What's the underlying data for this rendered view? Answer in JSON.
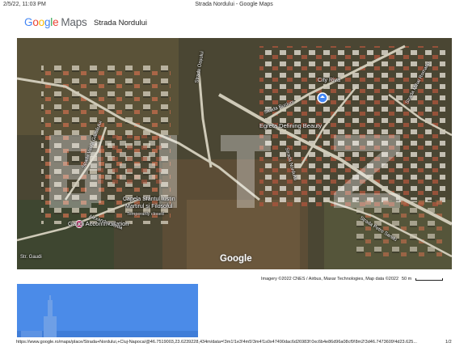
{
  "header": {
    "datetime": "2/5/22, 11:03 PM",
    "title": "Strada Nordului - Google Maps"
  },
  "logo": {
    "google": "Google",
    "maps": "Maps"
  },
  "place_name": "Strada Nordului",
  "map": {
    "watermark_text": "BITZ",
    "labels": {
      "city_riva": "City Riva",
      "egreta": "Egreta Defining Beauty",
      "capela_1": "Capela Sfântul Iustin",
      "capela_2": "Martirul și Filosoful",
      "temp_closed": "Temporarily closed",
      "gaudi": "Gaudi Accommodation",
      "strada_nordului": "Strada Nordului",
      "strada_oasului": "Strada Oașului",
      "strada_alexandru": "Alexandru Vaida",
      "strada_valea_gardului": "Strada Valea Gârbăului",
      "strada_sandu": "Strada Petre Sandu",
      "strada_mihai": "Strada Mihai Romanu",
      "strada_gaudi": "Str. Gaudi",
      "strada_alba": "Strada Bucium"
    },
    "google_watermark": "Google"
  },
  "attribution": "Imagery ©2022 CNES / Airbus, Maxar Technologies, Map data ©2022",
  "scale": "50 m",
  "url": "https://www.google.ro/maps/place/Strada+Nordului,+Cluj-Napoca/@46.7519003,23.6239228,434m/data=!3m1!1e3!4m5!3m4!1s0x47490dac6d26983f:0xc6b4e86d96a08cf9!8m2!3d46.7473609!4d23.625...",
  "page_num": "1/2",
  "colors": {
    "thumb_blue": "#4b8be8",
    "map_base": "#4c4a33"
  },
  "icons": [
    "location-pin-icon",
    "blue-place-marker-icon"
  ]
}
